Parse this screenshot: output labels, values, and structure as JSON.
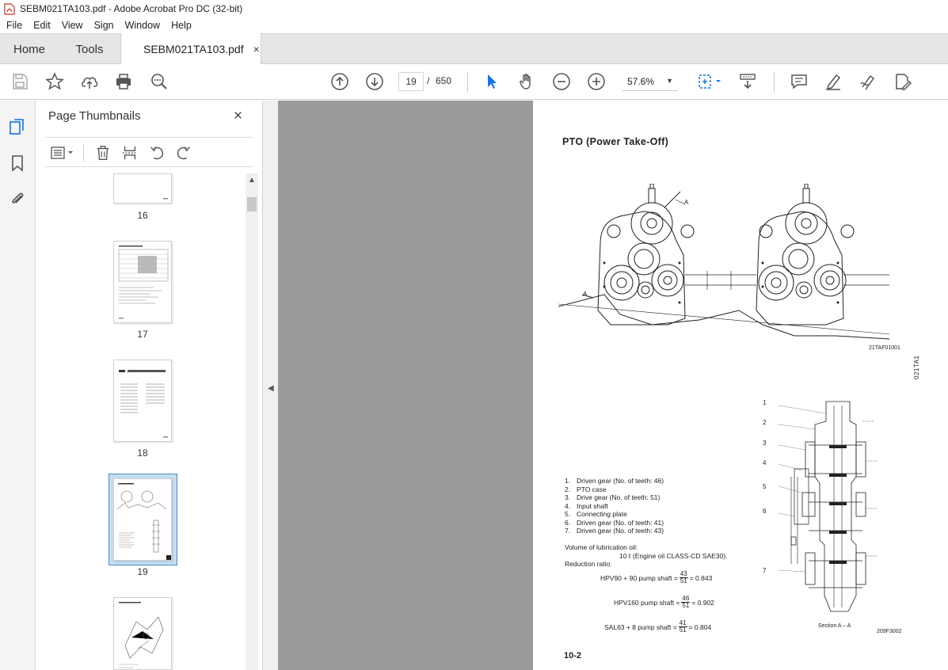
{
  "window": {
    "title": "SEBM021TA103.pdf - Adobe Acrobat Pro DC (32-bit)"
  },
  "menu": [
    "File",
    "Edit",
    "View",
    "Sign",
    "Window",
    "Help"
  ],
  "tabs": {
    "home": "Home",
    "tools": "Tools",
    "document": "SEBM021TA103.pdf",
    "close": "×"
  },
  "toolbar": {
    "current_page": "19",
    "separator": "/",
    "total_pages": "650",
    "zoom": "57.6%"
  },
  "thumbnails": {
    "title": "Page Thumbnails",
    "close": "×",
    "pages": [
      {
        "label": "16"
      },
      {
        "label": "17"
      },
      {
        "label": "18"
      },
      {
        "label": "19",
        "selected": true
      },
      {
        "label": ""
      }
    ]
  },
  "document": {
    "heading": "PTO  (Power  Take-Off)",
    "figure1_code": "21TAF01001",
    "figure1_callouts": {
      "a_top": "A",
      "a_left": "A"
    },
    "side_code": "021TA1",
    "parts": [
      {
        "num": "1.",
        "text": "Driven gear (No. of teeth: 46)"
      },
      {
        "num": "2.",
        "text": "PTO case"
      },
      {
        "num": "3.",
        "text": "Drive gear (No. of teeth: 51)"
      },
      {
        "num": "4.",
        "text": "Input shaft"
      },
      {
        "num": "5.",
        "text": "Connecting plate"
      },
      {
        "num": "6.",
        "text": "Driven gear (No. of teeth: 41)"
      },
      {
        "num": "7.",
        "text": "Driven gear (No. of teeth: 43)"
      }
    ],
    "lubrication_label": "Volume of lubrication oil:",
    "lubrication_value": "10 ℓ (Engine oil CLASS-CD SAE30).",
    "reduction_label": "Reduction ratio:",
    "ratios": [
      {
        "label": "HPV90 + 90 pump shaft =",
        "num": "43",
        "den": "51",
        "result": "= 0.843"
      },
      {
        "label": "HPV160 pump shaft =",
        "num": "46",
        "den": "51",
        "result": "= 0.902"
      },
      {
        "label": "SAL63 + 8 pump shaft =",
        "num": "41",
        "den": "51",
        "result": "= 0.804"
      }
    ],
    "figure2_callouts": [
      "1",
      "2",
      "3",
      "4",
      "5",
      "6",
      "7"
    ],
    "section_label": "Section A – A",
    "figure2_code": "209F3002",
    "page_number": "10-2"
  }
}
